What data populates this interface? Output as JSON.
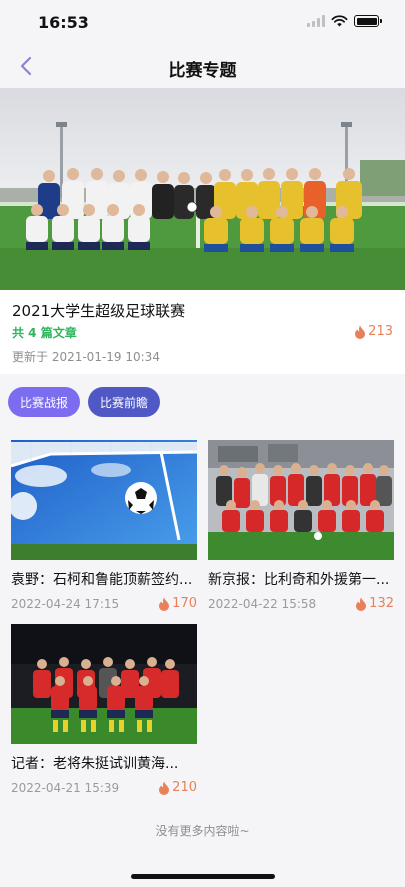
{
  "status_bar": {
    "time": "16:53"
  },
  "nav": {
    "title": "比赛专题"
  },
  "topic": {
    "title": "2021大学生超级足球联赛",
    "article_count": "共 4 篇文章",
    "heat": "213",
    "updated": "更新于  2021-01-19 10:34"
  },
  "tabs": [
    {
      "label": "比赛战报",
      "active": true
    },
    {
      "label": "比赛前瞻",
      "active": false
    }
  ],
  "articles": [
    {
      "title": "袁野：石柯和鲁能顶薪签约...",
      "date": "2022-04-24 17:15",
      "heat": "170"
    },
    {
      "title": "新京报：比利奇和外援第一...",
      "date": "2022-04-22 15:58",
      "heat": "132"
    },
    {
      "title": "记者：老将朱挺试训黄海...",
      "date": "2022-04-21 15:39",
      "heat": "210"
    }
  ],
  "footer": {
    "no_more": "没有更多内容啦~"
  },
  "colors": {
    "accent": "#7c6df0",
    "secondary": "#4f58c4",
    "heat": "#e8805a",
    "count": "#2fb55d"
  },
  "icons": {
    "back": "chevron-left-icon",
    "heat": "flame-icon"
  }
}
